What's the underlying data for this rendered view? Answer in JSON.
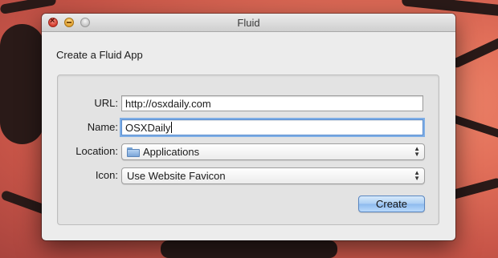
{
  "window": {
    "title": "Fluid"
  },
  "dialog": {
    "heading": "Create a Fluid App",
    "url": {
      "label": "URL:",
      "value": "http://osxdaily.com"
    },
    "name": {
      "label": "Name:",
      "value": "OSXDaily"
    },
    "location": {
      "label": "Location:",
      "value": "Applications",
      "icon": "folder-icon"
    },
    "icon": {
      "label": "Icon:",
      "value": "Use Website Favicon"
    },
    "create_label": "Create"
  },
  "colors": {
    "accent": "#8dbaee",
    "focus_ring": "#7eaee6",
    "close": "#d2382a",
    "minimize": "#e3a02a"
  }
}
